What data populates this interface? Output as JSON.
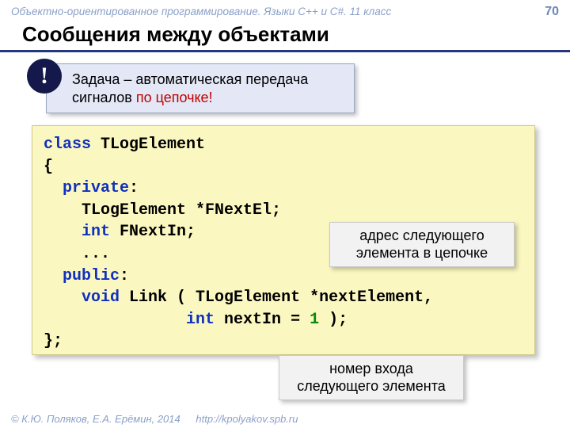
{
  "header": {
    "course": "Объектно-ориентированное программирование. Языки C++ и C#. 11 класс",
    "page": "70"
  },
  "title": "Сообщения между объектами",
  "task": {
    "line1": "Задача – автоматическая передача",
    "line2_pre": "сигналов ",
    "line2_em": "по цепочке!",
    "icon": "!"
  },
  "code": {
    "kw_class": "class",
    "cls": " TLogElement",
    "br1": "{",
    "kw_private": "private",
    "colon1": ":",
    "l1a": "    TLogElement *FNextEl;",
    "kw_int1": "int",
    "l2b": " FNextIn;",
    "dots": "    ...",
    "kw_public": "public",
    "colon2": ":",
    "kw_void": "void",
    "link_sig": " Link ( TLogElement *nextElement,",
    "indent_int": "               ",
    "kw_int2": "int",
    "afterInt": " nextIn = ",
    "num1": "1",
    "tail": " );",
    "br2": "};"
  },
  "callouts": {
    "c1a": "адрес следующего",
    "c1b": "элемента в цепочке",
    "c2a": "номер входа",
    "c2b": "следующего элемента"
  },
  "footer": {
    "copyright": "© К.Ю. Поляков, Е.А. Ерёмин, 2014",
    "url": "http://kpolyakov.spb.ru"
  }
}
